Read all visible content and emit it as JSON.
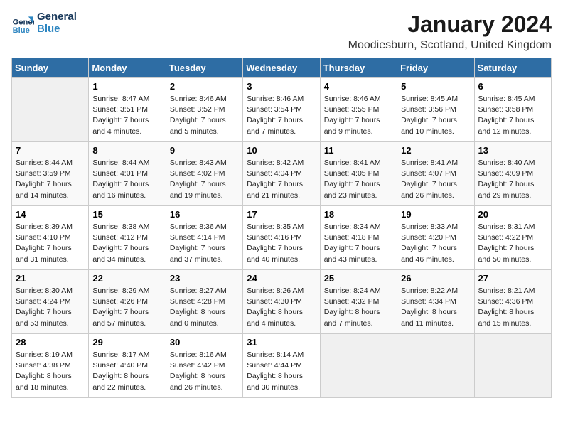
{
  "header": {
    "logo_line1": "General",
    "logo_line2": "Blue",
    "title": "January 2024",
    "subtitle": "Moodiesburn, Scotland, United Kingdom"
  },
  "columns": [
    "Sunday",
    "Monday",
    "Tuesday",
    "Wednesday",
    "Thursday",
    "Friday",
    "Saturday"
  ],
  "weeks": [
    [
      {
        "day": "",
        "content": ""
      },
      {
        "day": "1",
        "content": "Sunrise: 8:47 AM\nSunset: 3:51 PM\nDaylight: 7 hours\nand 4 minutes."
      },
      {
        "day": "2",
        "content": "Sunrise: 8:46 AM\nSunset: 3:52 PM\nDaylight: 7 hours\nand 5 minutes."
      },
      {
        "day": "3",
        "content": "Sunrise: 8:46 AM\nSunset: 3:54 PM\nDaylight: 7 hours\nand 7 minutes."
      },
      {
        "day": "4",
        "content": "Sunrise: 8:46 AM\nSunset: 3:55 PM\nDaylight: 7 hours\nand 9 minutes."
      },
      {
        "day": "5",
        "content": "Sunrise: 8:45 AM\nSunset: 3:56 PM\nDaylight: 7 hours\nand 10 minutes."
      },
      {
        "day": "6",
        "content": "Sunrise: 8:45 AM\nSunset: 3:58 PM\nDaylight: 7 hours\nand 12 minutes."
      }
    ],
    [
      {
        "day": "7",
        "content": "Sunrise: 8:44 AM\nSunset: 3:59 PM\nDaylight: 7 hours\nand 14 minutes."
      },
      {
        "day": "8",
        "content": "Sunrise: 8:44 AM\nSunset: 4:01 PM\nDaylight: 7 hours\nand 16 minutes."
      },
      {
        "day": "9",
        "content": "Sunrise: 8:43 AM\nSunset: 4:02 PM\nDaylight: 7 hours\nand 19 minutes."
      },
      {
        "day": "10",
        "content": "Sunrise: 8:42 AM\nSunset: 4:04 PM\nDaylight: 7 hours\nand 21 minutes."
      },
      {
        "day": "11",
        "content": "Sunrise: 8:41 AM\nSunset: 4:05 PM\nDaylight: 7 hours\nand 23 minutes."
      },
      {
        "day": "12",
        "content": "Sunrise: 8:41 AM\nSunset: 4:07 PM\nDaylight: 7 hours\nand 26 minutes."
      },
      {
        "day": "13",
        "content": "Sunrise: 8:40 AM\nSunset: 4:09 PM\nDaylight: 7 hours\nand 29 minutes."
      }
    ],
    [
      {
        "day": "14",
        "content": "Sunrise: 8:39 AM\nSunset: 4:10 PM\nDaylight: 7 hours\nand 31 minutes."
      },
      {
        "day": "15",
        "content": "Sunrise: 8:38 AM\nSunset: 4:12 PM\nDaylight: 7 hours\nand 34 minutes."
      },
      {
        "day": "16",
        "content": "Sunrise: 8:36 AM\nSunset: 4:14 PM\nDaylight: 7 hours\nand 37 minutes."
      },
      {
        "day": "17",
        "content": "Sunrise: 8:35 AM\nSunset: 4:16 PM\nDaylight: 7 hours\nand 40 minutes."
      },
      {
        "day": "18",
        "content": "Sunrise: 8:34 AM\nSunset: 4:18 PM\nDaylight: 7 hours\nand 43 minutes."
      },
      {
        "day": "19",
        "content": "Sunrise: 8:33 AM\nSunset: 4:20 PM\nDaylight: 7 hours\nand 46 minutes."
      },
      {
        "day": "20",
        "content": "Sunrise: 8:31 AM\nSunset: 4:22 PM\nDaylight: 7 hours\nand 50 minutes."
      }
    ],
    [
      {
        "day": "21",
        "content": "Sunrise: 8:30 AM\nSunset: 4:24 PM\nDaylight: 7 hours\nand 53 minutes."
      },
      {
        "day": "22",
        "content": "Sunrise: 8:29 AM\nSunset: 4:26 PM\nDaylight: 7 hours\nand 57 minutes."
      },
      {
        "day": "23",
        "content": "Sunrise: 8:27 AM\nSunset: 4:28 PM\nDaylight: 8 hours\nand 0 minutes."
      },
      {
        "day": "24",
        "content": "Sunrise: 8:26 AM\nSunset: 4:30 PM\nDaylight: 8 hours\nand 4 minutes."
      },
      {
        "day": "25",
        "content": "Sunrise: 8:24 AM\nSunset: 4:32 PM\nDaylight: 8 hours\nand 7 minutes."
      },
      {
        "day": "26",
        "content": "Sunrise: 8:22 AM\nSunset: 4:34 PM\nDaylight: 8 hours\nand 11 minutes."
      },
      {
        "day": "27",
        "content": "Sunrise: 8:21 AM\nSunset: 4:36 PM\nDaylight: 8 hours\nand 15 minutes."
      }
    ],
    [
      {
        "day": "28",
        "content": "Sunrise: 8:19 AM\nSunset: 4:38 PM\nDaylight: 8 hours\nand 18 minutes."
      },
      {
        "day": "29",
        "content": "Sunrise: 8:17 AM\nSunset: 4:40 PM\nDaylight: 8 hours\nand 22 minutes."
      },
      {
        "day": "30",
        "content": "Sunrise: 8:16 AM\nSunset: 4:42 PM\nDaylight: 8 hours\nand 26 minutes."
      },
      {
        "day": "31",
        "content": "Sunrise: 8:14 AM\nSunset: 4:44 PM\nDaylight: 8 hours\nand 30 minutes."
      },
      {
        "day": "",
        "content": ""
      },
      {
        "day": "",
        "content": ""
      },
      {
        "day": "",
        "content": ""
      }
    ]
  ]
}
